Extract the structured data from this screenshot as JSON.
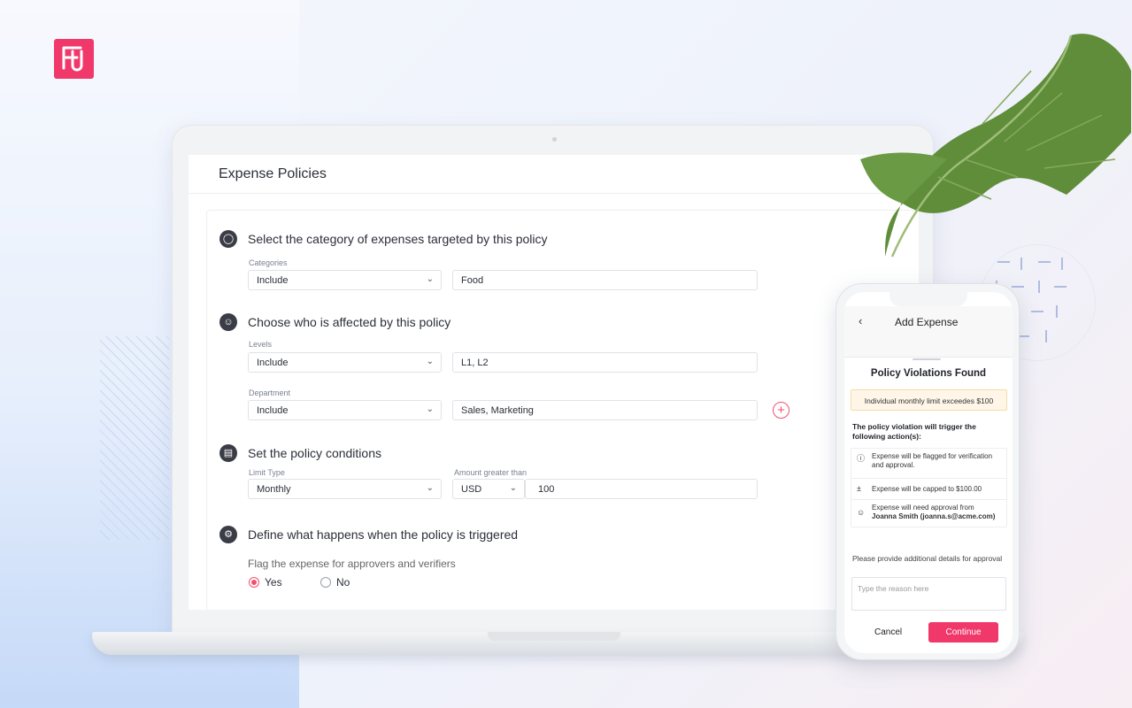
{
  "brand": {
    "logo_color": "#f0386b",
    "accent": "#f0506e"
  },
  "laptop": {
    "header_title": "Expense Policies",
    "sections": [
      {
        "icon": "tag-icon",
        "title": "Select the category of expenses targeted by this policy"
      },
      {
        "icon": "people-icon",
        "title": "Choose who is affected by this policy"
      },
      {
        "icon": "document-icon",
        "title": "Set the policy conditions"
      },
      {
        "icon": "wrench-icon",
        "title": "Define what happens when the policy is triggered"
      }
    ],
    "categories": {
      "label": "Categories",
      "mode": "Include",
      "value": "Food"
    },
    "levels": {
      "label": "Levels",
      "mode": "Include",
      "value": "L1, L2"
    },
    "department": {
      "label": "Department",
      "mode": "Include",
      "value": "Sales, Marketing"
    },
    "limit": {
      "label": "Limit Type",
      "value": "Monthly"
    },
    "amount": {
      "label": "Amount greater than",
      "currency": "USD",
      "value": "100"
    },
    "flag": {
      "question": "Flag the expense for approvers and verifiers",
      "yes": "Yes",
      "no": "No",
      "selected": "Yes"
    }
  },
  "phone": {
    "title": "Add Expense",
    "violations_title": "Policy Violations Found",
    "warning": "Individual monthly limit exceedes $100",
    "trigger_text": "The policy violation will trigger the following action(s):",
    "actions": [
      {
        "icon": "info-icon",
        "text": "Expense will be flagged for verification and approval."
      },
      {
        "icon": "plus-minus-icon",
        "text": "Expense will be capped to $100.00"
      },
      {
        "icon": "users-icon",
        "text": "Expense will need approval from",
        "bold": "Joanna Smith (joanna.s@acme.com)"
      }
    ],
    "reason_label": "Please provide additional details for approval",
    "reason_placeholder": "Type the reason here",
    "cancel": "Cancel",
    "continue": "Continue"
  }
}
